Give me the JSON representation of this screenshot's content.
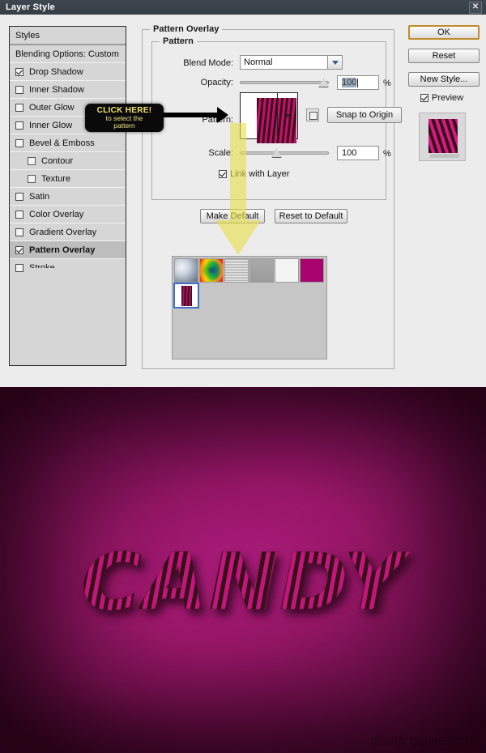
{
  "window": {
    "title": "Layer Style",
    "close_label": "✕"
  },
  "styles_panel": {
    "header": "Styles",
    "blending_options": "Blending Options: Custom",
    "items": [
      {
        "label": "Drop Shadow",
        "checked": true,
        "sub": false,
        "selected": false
      },
      {
        "label": "Inner Shadow",
        "checked": false,
        "sub": false,
        "selected": false
      },
      {
        "label": "Outer Glow",
        "checked": false,
        "sub": false,
        "selected": false
      },
      {
        "label": "Inner Glow",
        "checked": false,
        "sub": false,
        "selected": false
      },
      {
        "label": "Bevel & Emboss",
        "checked": false,
        "sub": false,
        "selected": false
      },
      {
        "label": "Contour",
        "checked": false,
        "sub": true,
        "selected": false
      },
      {
        "label": "Texture",
        "checked": false,
        "sub": true,
        "selected": false
      },
      {
        "label": "Satin",
        "checked": false,
        "sub": false,
        "selected": false
      },
      {
        "label": "Color Overlay",
        "checked": false,
        "sub": false,
        "selected": false
      },
      {
        "label": "Gradient Overlay",
        "checked": false,
        "sub": false,
        "selected": false
      },
      {
        "label": "Pattern Overlay",
        "checked": true,
        "sub": false,
        "selected": true
      },
      {
        "label": "Stroke",
        "checked": false,
        "sub": false,
        "selected": false
      }
    ]
  },
  "pattern_overlay": {
    "group_title": "Pattern Overlay",
    "inner_group_title": "Pattern",
    "blend_mode_label": "Blend Mode:",
    "blend_mode_value": "Normal",
    "opacity_label": "Opacity:",
    "opacity_value": "100",
    "opacity_unit": "%",
    "pattern_label": "Pattern:",
    "snap_to_origin_label": "Snap to Origin",
    "scale_label": "Scale:",
    "scale_value": "100",
    "scale_unit": "%",
    "link_with_layer_label": "Link with Layer",
    "link_with_layer_checked": true,
    "make_default_label": "Make Default",
    "reset_to_default_label": "Reset to Default"
  },
  "swatches": {
    "row1": [
      "clouds-pattern",
      "rainbow-gradient-pattern",
      "fine-lines-pattern",
      "gray-pattern",
      "white-pattern",
      "magenta-pattern"
    ],
    "row2": [
      "candy-stripe-pattern"
    ],
    "selected": "candy-stripe-pattern"
  },
  "buttons": {
    "ok": "OK",
    "reset": "Reset",
    "new_style": "New Style...",
    "preview_label": "Preview",
    "preview_checked": true
  },
  "annotation": {
    "line1": "CLICK HERE!",
    "line2": "to select the",
    "line3": "pattern",
    "text_color": "#f2e46a",
    "box_color": "#0a0a0a",
    "arrow_color": "#000000",
    "big_arrow_color": "#e8e04a"
  },
  "artwork": {
    "text": "CANDY",
    "watermark": "WWW.OUHE.COM",
    "background_color": "#a3186f",
    "stripe_dark": "#38101a",
    "stripe_pink": "#c2167c"
  }
}
